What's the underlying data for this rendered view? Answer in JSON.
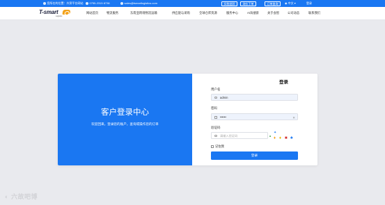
{
  "topbar": {
    "address": "您所在的位置：外贸平台网站",
    "phone": "0755-2315 8736",
    "email": "sales@tsmartlogistics.com",
    "buttons": [
      "实物追踪",
      "询价下单",
      "订单查询"
    ],
    "language": "中文",
    "login": "登录"
  },
  "nav": {
    "logo_text": "T-smart",
    "logo_tag": "Logistics",
    "items": [
      "网站首页",
      "物流服务",
      "东南亚跨境物流运输",
      "供应链与采购",
      "全球仓库资源",
      "服务中心",
      "AI海搜索",
      "关于会智",
      "公司动态",
      "联系我们"
    ]
  },
  "hero": {
    "title": "客户登录中心",
    "subtitle": "欢迎回来，登录您的账户，查询或操作您的订单"
  },
  "form": {
    "title": "登录",
    "username_label": "用户名",
    "username_value": "admin",
    "password_label": "密码",
    "password_value": "••••••",
    "captcha_label": "验证码",
    "captcha_placeholder": "请输入验证码",
    "remember_label": "记住我",
    "submit_label": "登录"
  },
  "watermark": "六故吧博",
  "colors": {
    "primary": "#1a77f2",
    "background": "#e9eaee",
    "accent": "#f3a21a"
  }
}
